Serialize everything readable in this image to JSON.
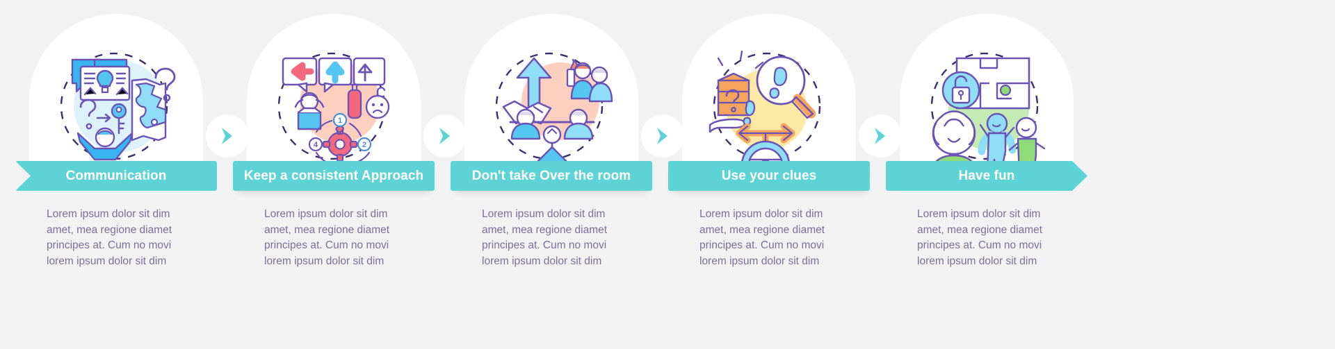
{
  "page": {
    "title": "Escape room tips infographic",
    "background_color": "#f2f2f2",
    "accent_color": "#5ed3d6",
    "text_color": "#7b6f9c",
    "card_color": "#ffffff"
  },
  "steps": [
    {
      "id": "communication",
      "label": "Communication",
      "banner_shape": "tail",
      "icon_name": "communication-icon",
      "description": "Lorem ipsum dolor sit dim amet, mea regione diamet principes at. Cum no movi lorem ipsum dolor sit dim"
    },
    {
      "id": "keep-a-consistent-approach",
      "label": "Keep a consistent Approach",
      "banner_shape": "plain",
      "icon_name": "consistent-approach-icon",
      "description": "Lorem ipsum dolor sit dim amet, mea regione diamet principes at. Cum no movi lorem ipsum dolor sit dim"
    },
    {
      "id": "dont-take-over-the-room",
      "label": "Don't take Over the room",
      "banner_shape": "plain",
      "icon_name": "teamwork-balance-icon",
      "description": "Lorem ipsum dolor sit dim amet, mea regione diamet principes at. Cum no movi lorem ipsum dolor sit dim"
    },
    {
      "id": "use-your-clues",
      "label": "Use your clues",
      "banner_shape": "plain",
      "icon_name": "clues-magnifier-icon",
      "description": "Lorem ipsum dolor sit dim amet, mea regione diamet principes at. Cum no movi lorem ipsum dolor sit dim"
    },
    {
      "id": "have-fun",
      "label": "Have fun",
      "banner_shape": "head",
      "icon_name": "have-fun-icon",
      "description": "Lorem ipsum dolor sit dim amet, mea regione diamet principes at. Cum no movi lorem ipsum dolor sit dim"
    }
  ],
  "connectors": [
    {
      "id": "connector-1",
      "icon_name": "chevron-right-icon"
    },
    {
      "id": "connector-2",
      "icon_name": "chevron-right-icon"
    },
    {
      "id": "connector-3",
      "icon_name": "chevron-right-icon"
    },
    {
      "id": "connector-4",
      "icon_name": "chevron-right-icon"
    }
  ]
}
